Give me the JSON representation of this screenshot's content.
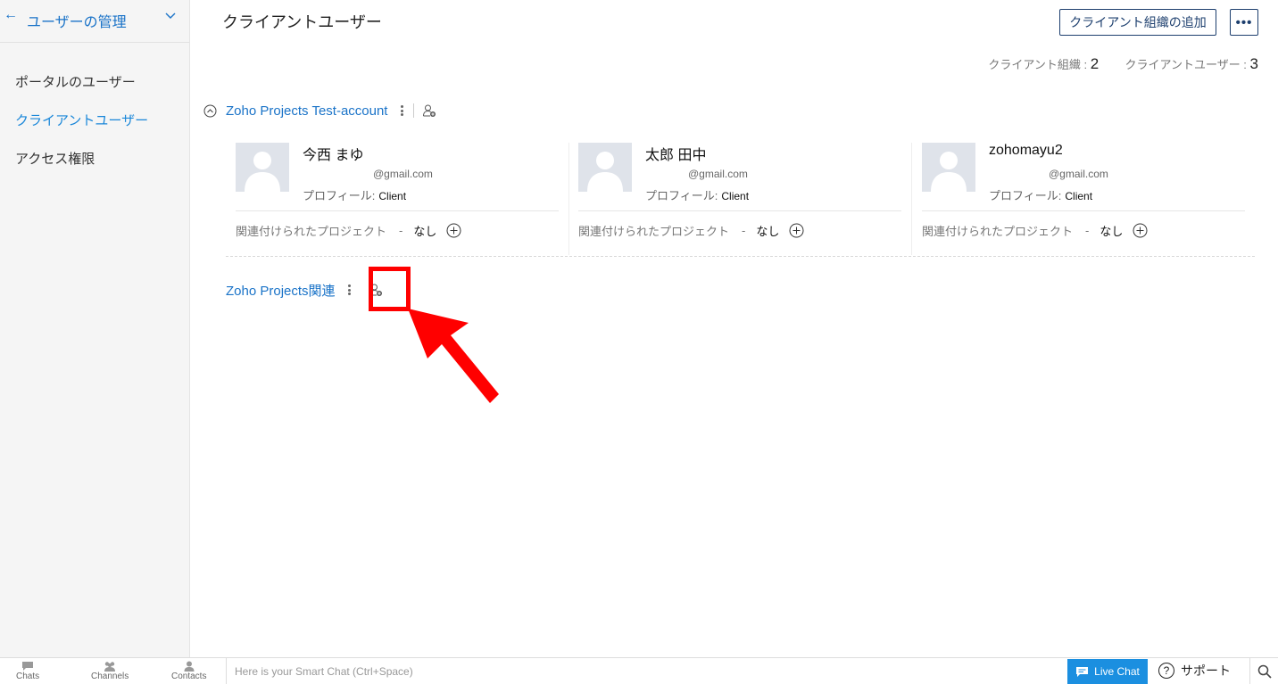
{
  "sidebar": {
    "title": "ユーザーの管理",
    "items": [
      {
        "label": "ポータルのユーザー",
        "active": false
      },
      {
        "label": "クライアントユーザー",
        "active": true
      },
      {
        "label": "アクセス権限",
        "active": false
      }
    ]
  },
  "header": {
    "title": "クライアントユーザー",
    "add_org_button": "クライアント組織の追加",
    "more_button": "•••"
  },
  "stats": {
    "orgs_label": "クライアント組織 : ",
    "orgs_count": "2",
    "users_label": "クライアントユーザー : ",
    "users_count": "3"
  },
  "organizations": [
    {
      "name": "Zoho Projects Test-account",
      "users": [
        {
          "name": "今西 まゆ",
          "email": "@gmail.com",
          "profile_label": "プロフィール:",
          "profile": "Client",
          "assoc_label": "関連付けられたプロジェクト",
          "dash": "-",
          "assoc_value": "なし"
        },
        {
          "name": "太郎 田中",
          "email": "@gmail.com",
          "profile_label": "プロフィール:",
          "profile": "Client",
          "assoc_label": "関連付けられたプロジェクト",
          "dash": "-",
          "assoc_value": "なし"
        },
        {
          "name": "zohomayu2",
          "email": "@gmail.com",
          "profile_label": "プロフィール:",
          "profile": "Client",
          "assoc_label": "関連付けられたプロジェクト",
          "dash": "-",
          "assoc_value": "なし"
        }
      ]
    },
    {
      "name": "Zoho Projects関連",
      "users": []
    }
  ],
  "bottombar": {
    "tabs": [
      {
        "label": "Chats",
        "icon": "chat-bubble-icon"
      },
      {
        "label": "Channels",
        "icon": "group-icon"
      },
      {
        "label": "Contacts",
        "icon": "person-icon"
      }
    ],
    "smartchat_placeholder": "Here is your Smart Chat (Ctrl+Space)",
    "live_chat": "Live Chat",
    "support": "サポート"
  },
  "colors": {
    "link": "#1a73c8",
    "active_nav": "#1a87d9",
    "button_border": "#1d3f6e",
    "live_chat_bg": "#1b8fe0",
    "annotation_red": "#ff0000"
  }
}
